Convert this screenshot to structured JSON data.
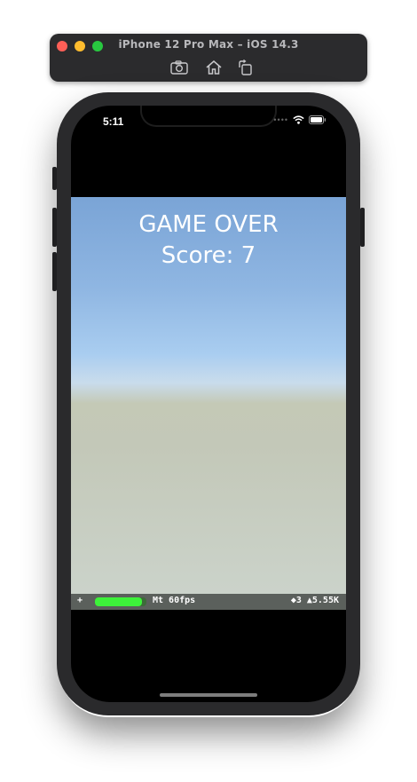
{
  "window": {
    "title": "iPhone 12 Pro Max – iOS 14.3",
    "toolbar": [
      {
        "name": "screenshot-icon",
        "label": "Screenshot"
      },
      {
        "name": "home-icon",
        "label": "Home"
      },
      {
        "name": "rotate-icon",
        "label": "Rotate"
      }
    ]
  },
  "status_bar": {
    "time": "5:11",
    "icons": [
      "cellular-dots-icon",
      "wifi-icon",
      "battery-icon"
    ]
  },
  "game": {
    "title": "GAME OVER",
    "score_text": "Score: 7"
  },
  "stats": {
    "plus": "+",
    "fps_level": 0.92,
    "fps_text": "Mt 60fps",
    "right_text": "◆3 ▲5.55K"
  },
  "colors": {
    "accent_green": "#3df13a",
    "traffic_close": "#fe5f57",
    "traffic_min": "#febc2e",
    "traffic_zoom": "#28c840"
  }
}
